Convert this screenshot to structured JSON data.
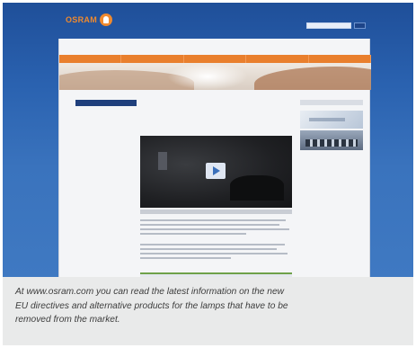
{
  "website": {
    "logo_text": "OSRAM",
    "toplinks": "",
    "nav_items": [
      "",
      "",
      "",
      "",
      ""
    ],
    "breadcrumb": "",
    "sidebar": {
      "head": "",
      "links": [
        "",
        "",
        ""
      ]
    },
    "main": {
      "title": "",
      "subtitle": ""
    },
    "right": {
      "head": "",
      "links": [
        "",
        "",
        ""
      ],
      "head2": "",
      "text": [
        "",
        "",
        ""
      ]
    }
  },
  "caption": {
    "lines": [
      "At www.osram.com you can read the latest information on the new",
      "EU directives and alternative products for the lamps that have to be",
      "removed from the market."
    ]
  },
  "colors": {
    "brand_orange": "#e97f2d",
    "header_blue": "#2a62b0",
    "caption_bg": "#e9eaea"
  },
  "icons": {
    "logo": "osram-bulb-icon",
    "video": "play-icon"
  }
}
